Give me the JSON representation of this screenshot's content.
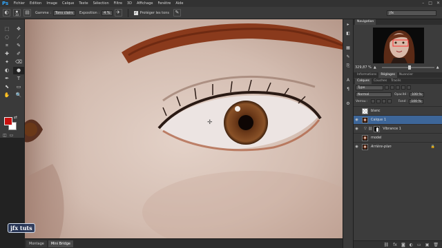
{
  "app": {
    "logo": "Ps"
  },
  "menu": [
    "Fichier",
    "Edition",
    "Image",
    "Calque",
    "Texte",
    "Sélection",
    "Filtre",
    "3D",
    "Affichage",
    "Fenêtre",
    "Aide"
  ],
  "window_buttons": [
    "–",
    "□",
    "✕"
  ],
  "options_bar": {
    "brush_size": "10",
    "range_label": "Gamme :",
    "range_value": "Tons clairs",
    "exposure_label": "Exposition :",
    "exposure_value": "4 %",
    "protect_label": "Protéger les tons",
    "workspace_value": "jfx"
  },
  "toolbar": {
    "tools": [
      "⬚",
      "✥",
      "◌",
      "⟋",
      "⌗",
      "✎",
      "✚",
      "✐",
      "✦",
      "⌫",
      "◐",
      "●",
      "✒",
      "T",
      "⬉",
      "▭",
      "✋",
      "🔍"
    ],
    "active_tool_index": 11,
    "foreground_color": "#c9100e",
    "background_color": "#ffffff"
  },
  "navigator": {
    "tabs": [
      "Navigation"
    ],
    "zoom": "329,87 %"
  },
  "info_tabs": [
    "Informations",
    "Réglages",
    "Nuancier"
  ],
  "layers_tabs": [
    "Calques",
    "Couches",
    "Tracés"
  ],
  "layers_panel": {
    "filter_label": "Type",
    "blend_mode": "Normal",
    "opacity_label": "Opacité :",
    "opacity_value": "100 %",
    "lock_label": "Verrou :",
    "fill_label": "Fond :",
    "fill_value": "100 %",
    "layers": [
      {
        "name": "blanc",
        "visible": false,
        "selected": false,
        "thumb": "checker",
        "has_mask": false,
        "italic": false,
        "locked": false
      },
      {
        "name": "Calque 1",
        "visible": true,
        "selected": true,
        "thumb": "face",
        "has_mask": false,
        "italic": false,
        "locked": false
      },
      {
        "name": "Vibrance 1",
        "visible": true,
        "selected": false,
        "thumb": "adjust",
        "has_mask": true,
        "italic": false,
        "locked": false
      },
      {
        "name": "model",
        "visible": false,
        "selected": false,
        "thumb": "face",
        "has_mask": false,
        "italic": false,
        "locked": false
      },
      {
        "name": "Arrière-plan",
        "visible": true,
        "selected": false,
        "thumb": "face",
        "has_mask": false,
        "italic": true,
        "locked": true
      }
    ]
  },
  "bottom_tabs": [
    "Montage",
    "Mini Bridge"
  ],
  "watermark": "jfx tuts"
}
